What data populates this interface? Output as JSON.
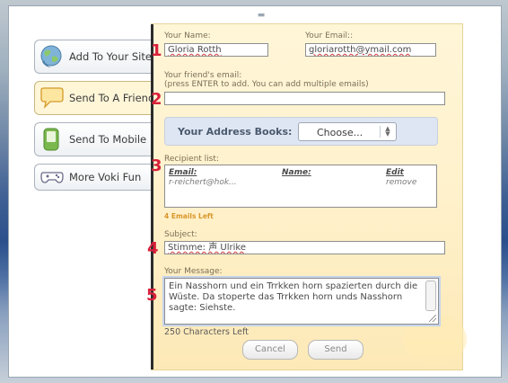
{
  "sidebar": {
    "items": [
      {
        "label": "Add To Your Site",
        "icon": "globe-icon"
      },
      {
        "label": "Send To A Friend",
        "icon": "speech-bubble-icon"
      },
      {
        "label": "Send To Mobile",
        "icon": "mobile-phone-icon"
      },
      {
        "label": "More Voki Fun",
        "icon": "gamepad-icon"
      }
    ],
    "active_index": 1
  },
  "form": {
    "your_name_label": "Your Name:",
    "your_name_value": "Gloria Rotth",
    "your_email_label": "Your Email::",
    "your_email_value": "gloriarotth@ymail.com",
    "friend_email_label": "Your friend's email:",
    "friend_email_hint": "(press ENTER to add. You can add multiple emails)",
    "friend_email_value": "",
    "address_books_label": "Your Address Books:",
    "address_books_selected": "Choose...",
    "recipient_list_label": "Recipient list:",
    "recipient_headers": {
      "email": "Email:",
      "name": "Name:",
      "edit": "Edit"
    },
    "recipient_rows": [
      {
        "email": "r-reichert@hok...",
        "name": "",
        "edit": "remove"
      }
    ],
    "emails_left": "4 Emails Left",
    "subject_label": "Subject:",
    "subject_value": "Stimme: 声  Ulrike",
    "message_label": "Your Message:",
    "message_value": "Ein Nasshorn und ein Trrkken horn spazierten durch die Wüste. Da stoperte das Trrkken horn unds Nasshorn sagte: Siehste.",
    "chars_left": "250 Characters Left",
    "cancel_label": "Cancel",
    "send_label": "Send"
  },
  "annotations": [
    "1",
    "2",
    "3",
    "4",
    "5"
  ],
  "colors": {
    "marker": "#d8203a",
    "panel_bg": "#fff6d8",
    "emails_left": "#d9962a"
  }
}
